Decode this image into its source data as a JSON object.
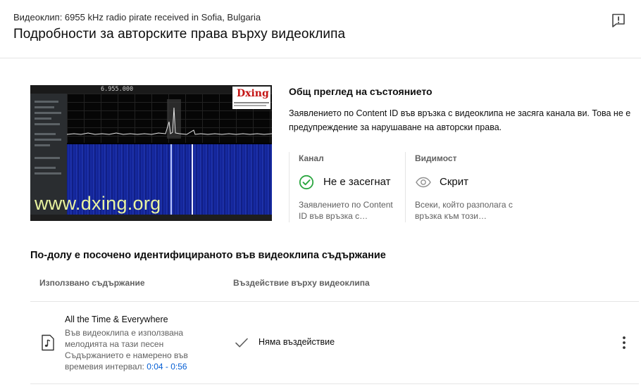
{
  "header": {
    "video_label": "Видеоклип: 6955 kHz radio pirate received in Sofia, Bulgaria",
    "title": "Подробности за авторските права върху видеоклипа",
    "feedback_icon": "feedback-flag-icon"
  },
  "thumbnail": {
    "frequency_readout": "6.955.000",
    "logo_text": "Dxing",
    "site_text": "www.dxing.org"
  },
  "overview": {
    "title": "Общ преглед на състоянието",
    "description": "Заявлението по Content ID във връзка с видеоклипа не засяга канала ви. Това не е предупреждение за нарушаване на авторски права.",
    "channel": {
      "label": "Канал",
      "value": "Не е засегнат",
      "icon": "check-circle-icon",
      "sub": "Заявлението по Content ID във връзка с…"
    },
    "visibility": {
      "label": "Видимост",
      "value": "Скрит",
      "icon": "eye-icon",
      "sub": "Всеки, който разполага с връзка към този…"
    }
  },
  "content": {
    "heading": "По-долу е посочено идентифицираното във видеоклипа съдържание",
    "columns": {
      "used": "Използвано съдържание",
      "impact": "Въздействие върху видеоклипа"
    },
    "rows": [
      {
        "title": "All the Time & Everywhere",
        "desc": "Във видеоклипа е използвана мелодията на тази песен Съдържанието е намерено във времевия интервал: ",
        "time_range": "0:04 - 0:56",
        "impact": "Няма въздействие",
        "icon": "music-note-icon"
      }
    ]
  },
  "colors": {
    "accent_blue": "#065fd4",
    "success_green": "#2ba640",
    "secondary_text": "#606060",
    "divider": "#e5e5e5"
  }
}
